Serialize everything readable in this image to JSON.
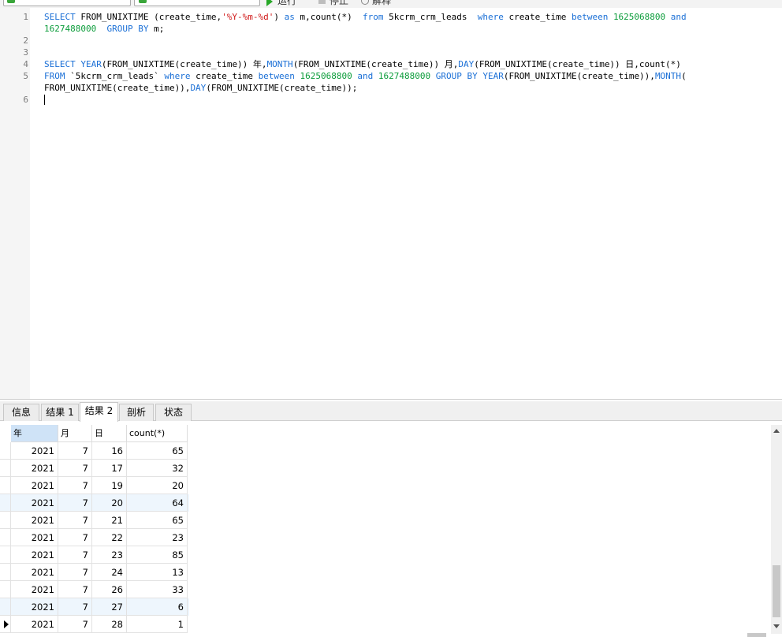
{
  "toolbar": {
    "run_label": "运行",
    "stop_label": "停止",
    "explain_label": "解释"
  },
  "editor": {
    "line_numbers": [
      "1",
      "2",
      "3",
      "4",
      "5",
      "6"
    ]
  },
  "sql": {
    "l1a_kw1": "SELECT",
    "l1a_t1": " FROM_UNIXTIME (create_time,",
    "l1a_str": "'%Y-%m-%d'",
    "l1a_t2": ") ",
    "l1a_kw2": "as",
    "l1a_t3": " m,count(*)  ",
    "l1a_kw3": "from",
    "l1a_t4": " 5kcrm_crm_leads  ",
    "l1a_kw4": "where",
    "l1a_t5": " create_time ",
    "l1a_kw5": "between",
    "l1a_t6": " ",
    "l1a_num1": "1625068800",
    "l1a_t7": " ",
    "l1a_kw6": "and",
    "l1b_num2": "1627488000",
    "l1b_t1": "  ",
    "l1b_kw1": "GROUP BY",
    "l1b_t2": " m;",
    "l4_kw1": "SELECT",
    "l4_t1": " ",
    "l4_kw2": "YEAR",
    "l4_t2": "(FROM_UNIXTIME(create_time)) 年,",
    "l4_kw3": "MONTH",
    "l4_t3": "(FROM_UNIXTIME(create_time)) 月,",
    "l4_kw4": "DAY",
    "l4_t4": "(FROM_UNIXTIME(create_time)) 日,count(*)",
    "l5a_kw1": "FROM",
    "l5a_t1": " `5kcrm_crm_leads` ",
    "l5a_kw2": "where",
    "l5a_t2": " create_time ",
    "l5a_kw3": "between",
    "l5a_t3": " ",
    "l5a_num1": "1625068800",
    "l5a_t4": " ",
    "l5a_kw4": "and",
    "l5a_t5": " ",
    "l5a_num2": "1627488000",
    "l5a_t6": " ",
    "l5a_kw5": "GROUP BY",
    "l5a_t7": " ",
    "l5a_kw6": "YEAR",
    "l5a_t8": "(FROM_UNIXTIME(create_time)),",
    "l5a_kw7": "MONTH",
    "l5a_t9": "(",
    "l5b_t1": "FROM_UNIXTIME(create_time)),",
    "l5b_kw1": "DAY",
    "l5b_t2": "(FROM_UNIXTIME(create_time));"
  },
  "tabs": [
    {
      "label": "信息"
    },
    {
      "label": "结果 1"
    },
    {
      "label": "结果 2",
      "active": true
    },
    {
      "label": "剖析"
    },
    {
      "label": "状态"
    }
  ],
  "grid": {
    "columns": [
      "年",
      "月",
      "日",
      "count(*)"
    ],
    "rows": [
      [
        "2021",
        "7",
        "16",
        "65"
      ],
      [
        "2021",
        "7",
        "17",
        "32"
      ],
      [
        "2021",
        "7",
        "19",
        "20"
      ],
      [
        "2021",
        "7",
        "20",
        "64"
      ],
      [
        "2021",
        "7",
        "21",
        "65"
      ],
      [
        "2021",
        "7",
        "22",
        "23"
      ],
      [
        "2021",
        "7",
        "23",
        "85"
      ],
      [
        "2021",
        "7",
        "24",
        "13"
      ],
      [
        "2021",
        "7",
        "26",
        "33"
      ],
      [
        "2021",
        "7",
        "27",
        "6"
      ],
      [
        "2021",
        "7",
        "28",
        "1"
      ]
    ],
    "highlighted_rows": [
      3,
      9
    ],
    "current_row": 10
  },
  "colors": {
    "keyword": "#1a6fd6",
    "string": "#d01919",
    "number": "#0b9c3a",
    "selected_header": "#cfe3f7",
    "row_highlight": "#eef6fd"
  }
}
